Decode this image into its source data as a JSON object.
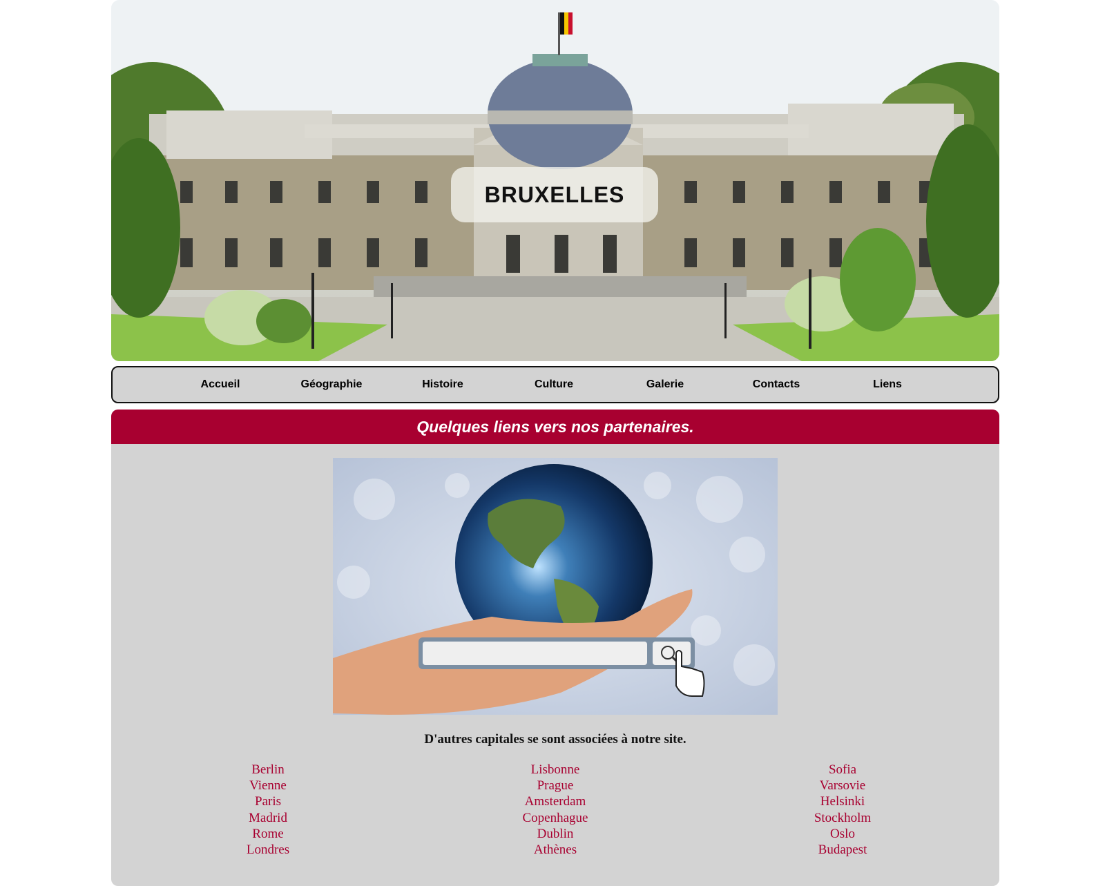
{
  "banner": {
    "title": "BRUXELLES",
    "image_description_icon": "palace-photo"
  },
  "nav": {
    "items": [
      {
        "label": "Accueil"
      },
      {
        "label": "Géographie"
      },
      {
        "label": "Histoire"
      },
      {
        "label": "Culture"
      },
      {
        "label": "Galerie"
      },
      {
        "label": "Contacts"
      },
      {
        "label": "Liens"
      }
    ]
  },
  "content": {
    "heading": "Quelques liens vers nos partenaires.",
    "image_icon": "globe-in-hand-search-illustration",
    "subtitle": "D'autres capitales se sont associées à notre site.",
    "columns": [
      [
        "Berlin",
        "Vienne",
        "Paris",
        "Madrid",
        "Rome",
        "Londres"
      ],
      [
        "Lisbonne",
        "Prague",
        "Amsterdam",
        "Copenhague",
        "Dublin",
        "Athènes"
      ],
      [
        "Sofia",
        "Varsovie",
        "Helsinki",
        "Stockholm",
        "Oslo",
        "Budapest"
      ]
    ]
  },
  "colors": {
    "accent": "#a80030",
    "panel_bg": "#d3d3d3",
    "link": "#a80030"
  }
}
